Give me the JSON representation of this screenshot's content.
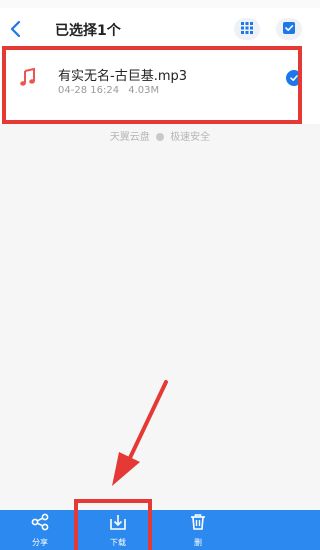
{
  "header": {
    "title": "已选择1个"
  },
  "file": {
    "name": "有实无名-古巨基.mp3",
    "date": "04-28 16:24",
    "size": "4.03M",
    "selected": true
  },
  "footer": {
    "brand": "天翼云盘",
    "tagline": "极速安全"
  },
  "toolbar": {
    "share_label": "分享",
    "download_label": "下载",
    "delete_label": "删"
  },
  "colors": {
    "accent": "#2b89ef",
    "highlight": "#e53935",
    "check": "#1e77e8",
    "music": "#ef5350"
  },
  "icons": {
    "back": "chevron-left-icon",
    "grid": "grid-icon",
    "select_all": "check-square-icon",
    "file": "music-note-icon",
    "share": "share-icon",
    "download": "download-icon",
    "delete": "trash-icon"
  }
}
